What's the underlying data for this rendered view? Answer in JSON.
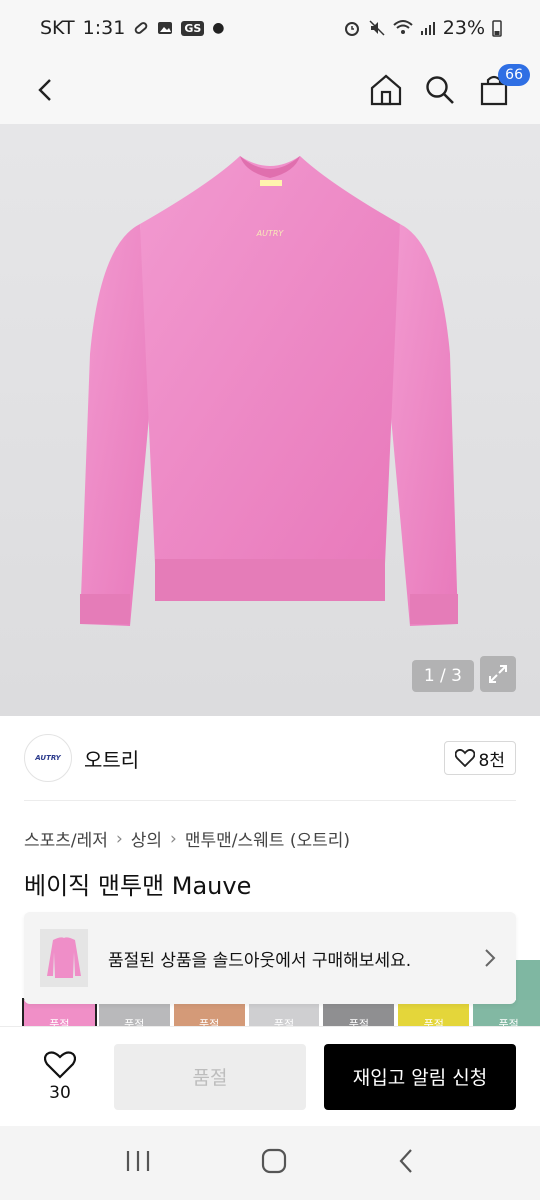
{
  "status_bar": {
    "carrier": "SKT",
    "time": "1:31",
    "gs_badge": "GS",
    "battery": "23%"
  },
  "nav": {
    "cart_count": "66"
  },
  "gallery": {
    "counter": "1 / 3"
  },
  "brand": {
    "logo_text": "AUTRY",
    "name": "오트리",
    "likes": "8천"
  },
  "breadcrumb": [
    "스포츠/레저",
    "상의",
    "맨투맨/스웨트 (오트리)"
  ],
  "product": {
    "title": "베이직 맨투맨 Mauve"
  },
  "soldout_banner": {
    "message": "품절된 상품을 솔드아웃에서 구매해보세요."
  },
  "color_thumbs": {
    "colors": [
      "#f08fc7",
      "#b9b9bb",
      "#d49a78",
      "#cfcfd1",
      "#8f8f91",
      "#e4d63a",
      "#82b8a3"
    ],
    "label": "품절"
  },
  "bottom_bar": {
    "wish_count": "30",
    "soldout_label": "품절",
    "notify_label": "재입고 알림 신청"
  },
  "icons": [
    "back-icon",
    "home-icon",
    "search-icon",
    "cart-icon",
    "expand-icon",
    "heart-icon",
    "chevron-right-icon",
    "recent-apps-icon",
    "android-home-icon",
    "android-back-icon"
  ]
}
